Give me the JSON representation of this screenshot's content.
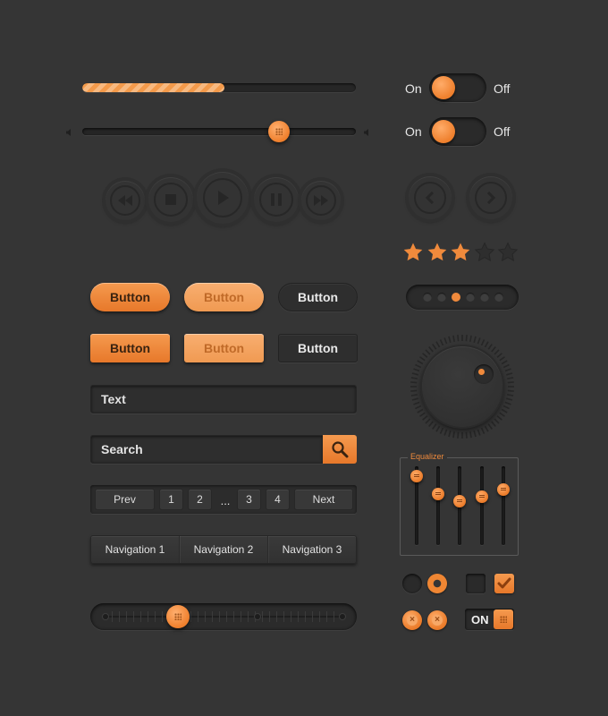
{
  "theme": {
    "background": "#353535",
    "accent": "#f08a3c"
  },
  "progress": {
    "value_percent": 52
  },
  "volume_slider": {
    "value_percent": 72,
    "min_icon": "speaker-low-icon",
    "max_icon": "speaker-high-icon"
  },
  "toggles": [
    {
      "on_label": "On",
      "off_label": "Off",
      "state": "on"
    },
    {
      "on_label": "On",
      "off_label": "Off",
      "state": "on"
    }
  ],
  "media_controls": [
    "rewind-icon",
    "stop-icon",
    "play-icon",
    "pause-icon",
    "fast-forward-icon"
  ],
  "nav_arrows": [
    "arrow-left-icon",
    "arrow-right-icon"
  ],
  "rating": {
    "value": 3,
    "max": 5
  },
  "pager_dots": {
    "count": 6,
    "active_index": 2
  },
  "buttons": {
    "pill": [
      "Button",
      "Button",
      "Button"
    ],
    "rect": [
      "Button",
      "Button",
      "Button"
    ]
  },
  "text_field": {
    "value": "Text"
  },
  "search": {
    "value": "Search",
    "icon": "magnifier-icon"
  },
  "pagination": {
    "prev": "Prev",
    "pages": [
      "1",
      "2",
      "...",
      "3",
      "4"
    ],
    "next": "Next"
  },
  "navigation": [
    "Navigation 1",
    "Navigation 2",
    "Navigation 3"
  ],
  "range_slider": {
    "value_percent": 33
  },
  "knob": {
    "indicator": "top-right"
  },
  "equalizer": {
    "title": "Equalizer",
    "levels_percent": [
      88,
      65,
      56,
      61,
      70
    ]
  },
  "radios": [
    {
      "state": "off"
    },
    {
      "state": "on"
    }
  ],
  "checkboxes": [
    {
      "state": "off"
    },
    {
      "state": "on"
    }
  ],
  "close_buttons": [
    "close-icon",
    "close-icon"
  ],
  "on_switch": {
    "label": "ON"
  }
}
